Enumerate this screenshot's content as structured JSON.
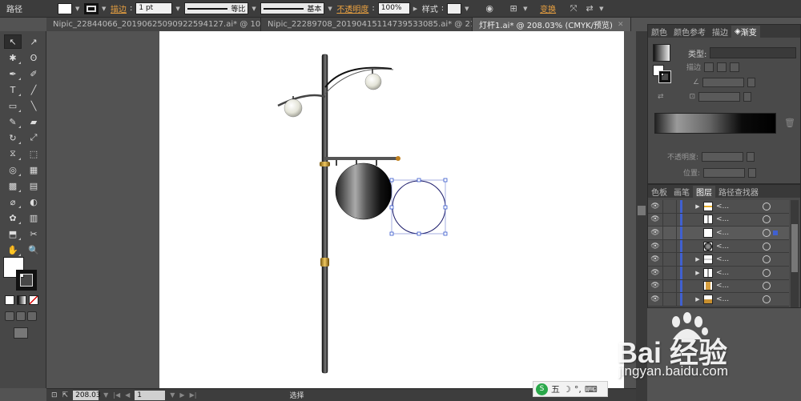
{
  "control_bar": {
    "object_type": "路径",
    "stroke_label": "描边",
    "stroke_weight": "1 pt",
    "stroke_profile": "等比",
    "brush": "基本",
    "opacity_label": "不透明度",
    "opacity_value": "100%",
    "style_label": "样式",
    "transform_label": "变换"
  },
  "tabs": [
    {
      "label": "Nipic_22844066_20190625090922594127.ai* @ 10...",
      "active": false
    },
    {
      "label": "Nipic_22289708_20190415114739533085.ai* @ 21...",
      "active": false
    },
    {
      "label": "灯杆1.ai* @ 208.03% (CMYK/预览)",
      "active": true
    }
  ],
  "tools": [
    {
      "name": "selection-tool",
      "glyph": "↖"
    },
    {
      "name": "direct-selection-tool",
      "glyph": "↗"
    },
    {
      "name": "magic-wand-tool",
      "glyph": "✱"
    },
    {
      "name": "lasso-tool",
      "glyph": "ʘ"
    },
    {
      "name": "pen-tool",
      "glyph": "✒"
    },
    {
      "name": "curvature-tool",
      "glyph": "✐"
    },
    {
      "name": "type-tool",
      "glyph": "T"
    },
    {
      "name": "line-tool",
      "glyph": "╱"
    },
    {
      "name": "rectangle-tool",
      "glyph": "▭"
    },
    {
      "name": "paintbrush-tool",
      "glyph": "╲"
    },
    {
      "name": "pencil-tool",
      "glyph": "✎"
    },
    {
      "name": "eraser-tool",
      "glyph": "▰"
    },
    {
      "name": "rotate-tool",
      "glyph": "↻"
    },
    {
      "name": "scale-tool",
      "glyph": "⤢"
    },
    {
      "name": "width-tool",
      "glyph": "⧖"
    },
    {
      "name": "free-transform-tool",
      "glyph": "⬚"
    },
    {
      "name": "shape-builder-tool",
      "glyph": "◎"
    },
    {
      "name": "perspective-grid-tool",
      "glyph": "▦"
    },
    {
      "name": "mesh-tool",
      "glyph": "▩"
    },
    {
      "name": "gradient-tool",
      "glyph": "▤"
    },
    {
      "name": "eyedropper-tool",
      "glyph": "⌀"
    },
    {
      "name": "blend-tool",
      "glyph": "◐"
    },
    {
      "name": "symbol-sprayer-tool",
      "glyph": "✿"
    },
    {
      "name": "column-graph-tool",
      "glyph": "▥"
    },
    {
      "name": "artboard-tool",
      "glyph": "⬒"
    },
    {
      "name": "slice-tool",
      "glyph": "✂"
    },
    {
      "name": "hand-tool",
      "glyph": "✋"
    },
    {
      "name": "zoom-tool",
      "glyph": "🔍"
    }
  ],
  "right_panel": {
    "top_tabs": [
      "颜色",
      "颜色参考",
      "描边",
      "渐变"
    ],
    "type_label": "类型:",
    "stroke_label": "描边",
    "opacity_label": "不透明度:",
    "position_label": "位置:",
    "layers_tabs": [
      "色板",
      "画笔",
      "图层",
      "路径查找器"
    ],
    "layers": [
      {
        "name": "<...",
        "thumb": "yellow",
        "has_children": true
      },
      {
        "name": "<...",
        "thumb": "white-line",
        "has_children": false
      },
      {
        "name": "<...",
        "thumb": "white",
        "has_children": false,
        "selected": true
      },
      {
        "name": "<...",
        "thumb": "gradient",
        "has_children": false
      },
      {
        "name": "<...",
        "thumb": "white-bar",
        "has_children": true
      },
      {
        "name": "<...",
        "thumb": "white-line",
        "has_children": true
      },
      {
        "name": "<...",
        "thumb": "gold",
        "has_children": false
      },
      {
        "name": "<...",
        "thumb": "gold-small",
        "has_children": true
      }
    ]
  },
  "status": {
    "zoom": "208.03",
    "artboard": "1",
    "status_text": "选择"
  },
  "ime": {
    "label": "五"
  },
  "watermark": {
    "logo_text": "Bai 经验",
    "url": "jingyan.baidu.com"
  },
  "colors": {
    "accent": "#e8a040",
    "layer_color": "#4060d0",
    "selection": "#3355cc"
  }
}
